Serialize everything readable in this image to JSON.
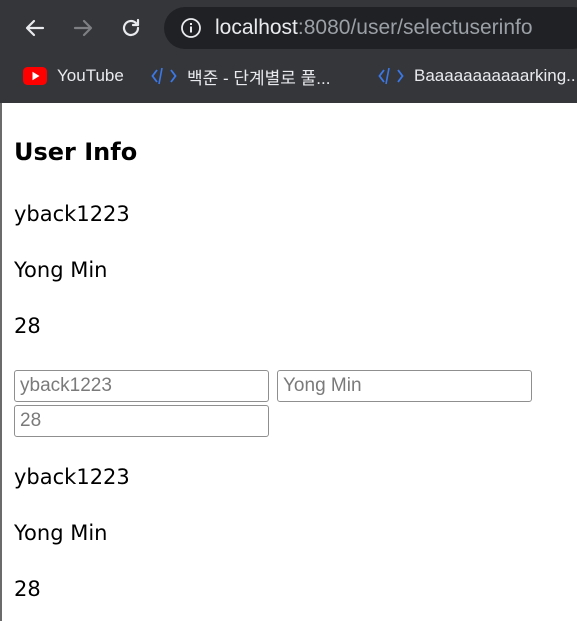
{
  "browser": {
    "url_host": "localhost",
    "url_rest": ":8080/user/selectuserinfo",
    "bookmarks": [
      {
        "label": "YouTube",
        "icon": "youtube-icon"
      },
      {
        "label": "백준 - 단계별로 풀...",
        "icon": "code-brackets-icon"
      },
      {
        "label": "Baaaaaaaaaaarking...",
        "icon": "code-brackets-icon"
      }
    ]
  },
  "page": {
    "title": "User Info",
    "display_top": {
      "id": "yback1223",
      "name": "Yong Min",
      "age": "28"
    },
    "form": {
      "id_placeholder": "yback1223",
      "name_placeholder": "Yong Min",
      "age_placeholder": "28"
    },
    "display_bottom": {
      "id": "yback1223",
      "name": "Yong Min",
      "age": "28"
    }
  },
  "colors": {
    "chrome_bg": "#35363a",
    "omnibox_bg": "#202124",
    "youtube_red": "#ff0000",
    "bookmark_icon_blue": "#3b78e7"
  }
}
